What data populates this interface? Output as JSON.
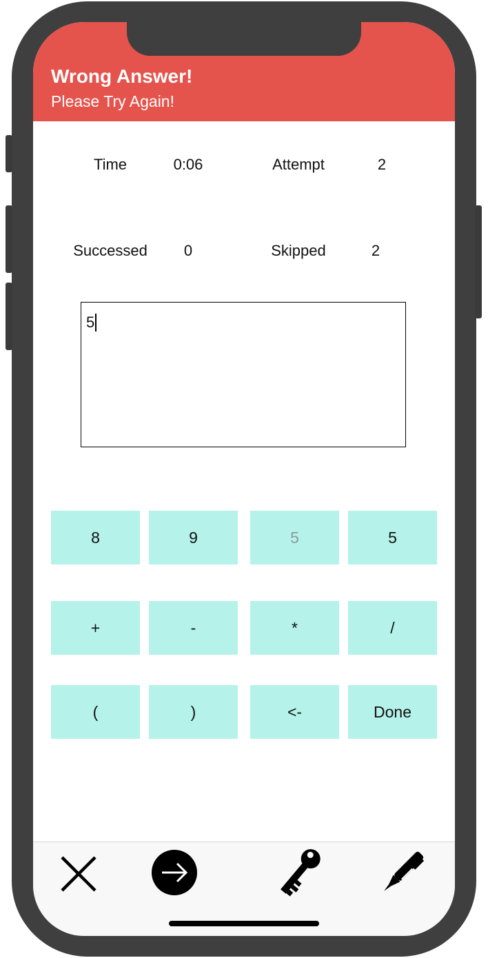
{
  "banner": {
    "title": "Wrong Answer!",
    "subtitle": "Please Try Again!",
    "color": "#e5534d"
  },
  "stats": {
    "time_label": "Time",
    "time_value": "0:06",
    "attempt_label": "Attempt",
    "attempt_value": "2",
    "successed_label": "Successed",
    "successed_value": "0",
    "skipped_label": "Skipped",
    "skipped_value": "2"
  },
  "answer": {
    "value": "5"
  },
  "keypad": {
    "key_color": "#b5f2ea",
    "keys": [
      {
        "label": "8",
        "disabled": false
      },
      {
        "label": "9",
        "disabled": false
      },
      {
        "label": "5",
        "disabled": true
      },
      {
        "label": "5",
        "disabled": false
      },
      {
        "label": "+",
        "disabled": false
      },
      {
        "label": "-",
        "disabled": false
      },
      {
        "label": "*",
        "disabled": false
      },
      {
        "label": "/",
        "disabled": false
      },
      {
        "label": "(",
        "disabled": false
      },
      {
        "label": ")",
        "disabled": false
      },
      {
        "label": "<-",
        "disabled": false
      },
      {
        "label": "Done",
        "disabled": false
      }
    ]
  },
  "toolbar": {
    "icons": [
      "close-icon",
      "arrow-right-circle-icon",
      "key-icon",
      "pen-icon"
    ]
  }
}
